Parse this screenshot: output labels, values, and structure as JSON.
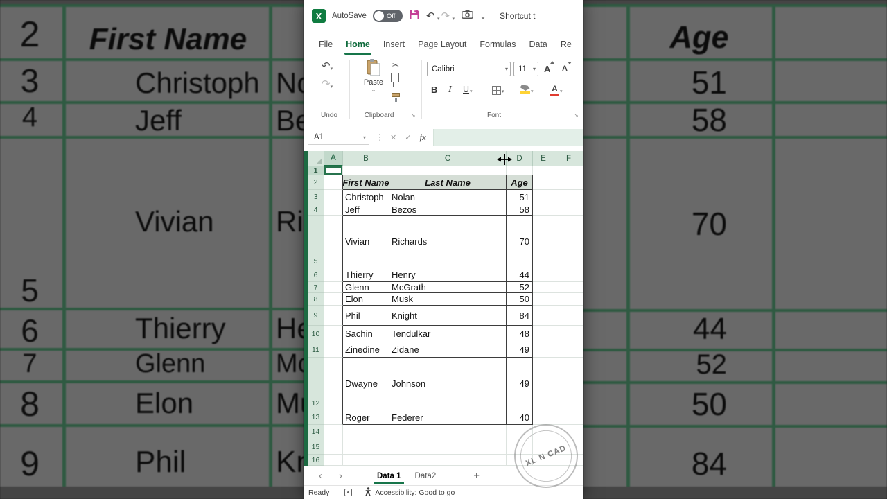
{
  "chrome": {
    "autosave_label": "AutoSave",
    "autosave_state": "Off",
    "shortcut_text": "Shortcut t",
    "tabs": [
      "File",
      "Home",
      "Insert",
      "Page Layout",
      "Formulas",
      "Data",
      "Re"
    ],
    "active_tab": "Home",
    "ribbon": {
      "undo_group": "Undo",
      "clipboard_group": "Clipboard",
      "paste_label": "Paste",
      "font_group": "Font",
      "font_name": "Calibri",
      "font_size": "11",
      "bold_label": "B",
      "italic_label": "I",
      "underline_label": "U"
    },
    "formula_bar": {
      "name_box": "A1",
      "fx_label": "fx",
      "value": ""
    },
    "icons": {
      "undo": "↶",
      "redo": "↷",
      "dropdown": "▾",
      "chevron_down": "⌄",
      "cut": "✂",
      "dots": "⋮",
      "cancel": "✕",
      "enter": "✓",
      "launcher": "↘",
      "prev": "‹",
      "next": "›",
      "add": "+",
      "increase_font": "A",
      "decrease_font": "A"
    }
  },
  "grid": {
    "column_headers": [
      "A",
      "B",
      "C",
      "D",
      "E",
      "F"
    ],
    "row_numbers": [
      "1",
      "2",
      "3",
      "4",
      "5",
      "6",
      "7",
      "8",
      "9",
      "10",
      "11",
      "12",
      "13",
      "14",
      "15",
      "16"
    ],
    "selected_cell": "A1"
  },
  "table": {
    "headers": {
      "first": "First Name",
      "last": "Last Name",
      "age": "Age"
    },
    "rows": [
      {
        "first": "Christoph",
        "last": "Nolan",
        "age": "51"
      },
      {
        "first": "Jeff",
        "last": "Bezos",
        "age": "58"
      },
      {
        "first": "Vivian",
        "last": "Richards",
        "age": "70"
      },
      {
        "first": "Thierry",
        "last": "Henry",
        "age": "44"
      },
      {
        "first": "Glenn",
        "last": "McGrath",
        "age": "52"
      },
      {
        "first": "Elon",
        "last": "Musk",
        "age": "50"
      },
      {
        "first": "Phil",
        "last": "Knight",
        "age": "84"
      },
      {
        "first": "Sachin",
        "last": "Tendulkar",
        "age": "48"
      },
      {
        "first": "Zinedine",
        "last": "Zidane",
        "age": "49"
      },
      {
        "first": "Dwayne",
        "last": "Johnson",
        "age": "49"
      },
      {
        "first": "Roger",
        "last": "Federer",
        "age": "40"
      }
    ]
  },
  "sheet_bar": {
    "tabs": [
      {
        "label": "Data 1",
        "active": true
      },
      {
        "label": "Data2",
        "active": false
      }
    ]
  },
  "status_bar": {
    "ready": "Ready",
    "accessibility": "Accessibility: Good to go"
  },
  "watermark": {
    "text": "XL N CAD"
  },
  "colors": {
    "excel_green": "#107C41",
    "save_icon": "#c43e96",
    "fill_yellow": "#ffd335",
    "font_red": "#e03c31"
  }
}
